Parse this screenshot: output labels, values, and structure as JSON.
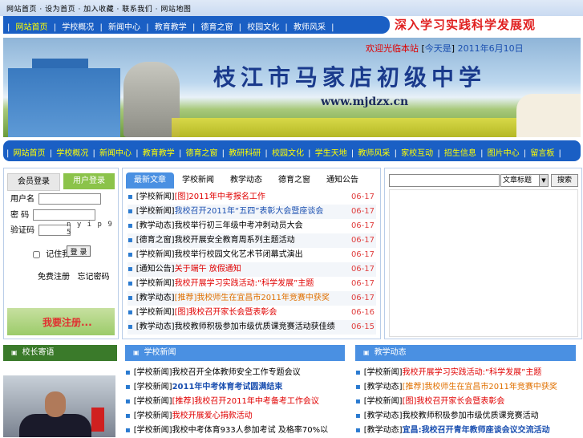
{
  "top_links": "网站首页 · 设为首页 · 加入收藏 · 联系我们 · 网站地图",
  "nav_primary": [
    "网站首页",
    "学校概况",
    "新闻中心",
    "教育教学",
    "德育之窗",
    "校园文化",
    "教师风采"
  ],
  "slogan": "深入学习实践科学发展观",
  "banner": {
    "school_name": "枝江市马家店初级中学",
    "url": "www.mjdzx.cn",
    "welcome_prefix": "欢迎光临本站",
    "date_label": "今天是",
    "date_value": "2011年6月10日"
  },
  "nav_secondary": [
    "网站首页",
    "学校概况",
    "新闻中心",
    "教育教学",
    "德育之窗",
    "教研科研",
    "校园文化",
    "学生天地",
    "教师风采",
    "家校互动",
    "招生信息",
    "图片中心",
    "留言板"
  ],
  "login": {
    "tab_a": "会员登录",
    "tab_b": "用户登录",
    "user_label": "用户名",
    "pass_label": "密  码",
    "code_label": "验证码",
    "captcha": "n y i p 9 5",
    "remember_label": "记住我",
    "login_button": "登 录",
    "register_link": "免费注册",
    "forgot_link": "忘记密码",
    "register_banner": "我要注册..."
  },
  "news_tabs": [
    "最新文章",
    "学校新闻",
    "教学动态",
    "德育之窗",
    "通知公告"
  ],
  "news": [
    {
      "cat": "[学校新闻]",
      "tag": "[图]",
      "title": "2011年中考报名工作",
      "date": "06-17",
      "style": "red"
    },
    {
      "cat": "[学校新闻]",
      "tag": "",
      "title": "我校召开2011年“五四”表彰大会暨座谈会",
      "date": "06-17",
      "style": "blue"
    },
    {
      "cat": "[教学动态]",
      "tag": "",
      "title": "我校举行初三年级中考冲刺动员大会",
      "date": "06-17",
      "style": "plain"
    },
    {
      "cat": "[德育之窗]",
      "tag": "",
      "title": "我校开展安全教育周系列主题活动",
      "date": "06-17",
      "style": "plain"
    },
    {
      "cat": "[学校新闻]",
      "tag": "",
      "title": "我校举行校园文化艺术节闭幕式演出",
      "date": "06-17",
      "style": "plain"
    },
    {
      "cat": "[通知公告]",
      "tag": "",
      "title": "关于端午 放假通知",
      "date": "06-17",
      "style": "red"
    },
    {
      "cat": "[学校新闻]",
      "tag": "",
      "title": "我校开展学习实践活动:“科学发展”主题",
      "date": "06-17",
      "style": "red"
    },
    {
      "cat": "[教学动态]",
      "tag": "[推荐]",
      "title": "我校师生在宜昌市2011年竞赛中获奖",
      "date": "06-17",
      "style": "orange"
    },
    {
      "cat": "[学校新闻]",
      "tag": "[图]",
      "title": "我校召开家长会暨表彰会",
      "date": "06-16",
      "style": "red"
    },
    {
      "cat": "[教学动态]",
      "tag": "",
      "title": "我校教师积极参加市级优质课竞赛活动获佳绩",
      "date": "06-15",
      "style": "plain"
    }
  ],
  "search": {
    "select_label": "文章标题",
    "button": "搜索"
  },
  "section_principal": "校长寄语",
  "section_school_news": "学校新闻",
  "section_teaching": "教学动态",
  "school_news": [
    {
      "cat": "[学校新闻]",
      "tag": "",
      "title": "我校召开全体教师安全工作专题会议",
      "style": "plain"
    },
    {
      "cat": "[学校新闻]",
      "tag": "",
      "title": "2011年中考体育考试圆满结束",
      "style": "blue"
    },
    {
      "cat": "[学校新闻]",
      "tag": "[推荐]",
      "title": "我校召开2011年中考备考工作会议",
      "style": "red"
    },
    {
      "cat": "[学校新闻]",
      "tag": "",
      "title": "我校开展爱心捐款活动",
      "style": "red"
    },
    {
      "cat": "[学校新闻]",
      "tag": "",
      "title": "我校中考体育933人参加考试 及格率70%以",
      "style": "plain"
    }
  ],
  "teaching_news": [
    {
      "cat": "[学校新闻]",
      "tag": "",
      "title": "我校开展学习实践活动:“科学发展”主题",
      "style": "red"
    },
    {
      "cat": "[教学动态]",
      "tag": "[推荐]",
      "title": "我校师生在宜昌市2011年竞赛中获奖",
      "style": "orange"
    },
    {
      "cat": "[学校新闻]",
      "tag": "[图]",
      "title": "我校召开家长会暨表彰会",
      "style": "red"
    },
    {
      "cat": "[教学动态]",
      "tag": "",
      "title": "我校教师积极参加市级优质课竞赛活动",
      "style": "plain"
    },
    {
      "cat": "[教学动态]",
      "tag": "",
      "title": "宜昌:我校召开青年教师座谈会议交流活动",
      "style": "blue"
    }
  ]
}
